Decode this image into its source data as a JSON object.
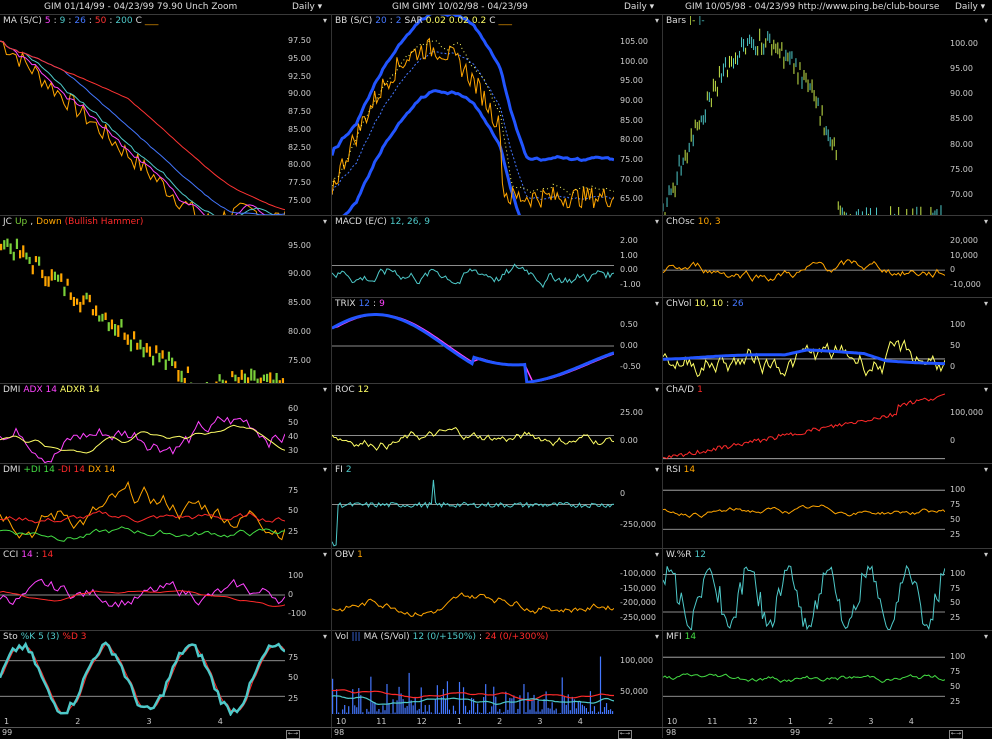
{
  "columns": [
    {
      "header": "GIM  01/14/99 - 04/23/99   79.90   Unch    Zoom",
      "period": "Daily",
      "panels": [
        {
          "legend": [
            {
              "t": "MA (S/C)",
              "c": "#dddddd"
            },
            {
              "t": "5",
              "c": "#ff44ff"
            },
            {
              "t": ":",
              "c": "#dddddd"
            },
            {
              "t": "9",
              "c": "#4ec9c9"
            },
            {
              "t": ":",
              "c": "#dddddd"
            },
            {
              "t": "26",
              "c": "#4477ff"
            },
            {
              "t": ":",
              "c": "#dddddd"
            },
            {
              "t": "50",
              "c": "#ff3333"
            },
            {
              "t": ":",
              "c": "#dddddd"
            },
            {
              "t": "200",
              "c": "#4ec9c9"
            },
            {
              "t": "C",
              "c": "#dddddd"
            },
            {
              "t": "___",
              "c": "#ffa500"
            }
          ],
          "ticks": [
            "97.50",
            "95.00",
            "92.50",
            "90.00",
            "87.50",
            "85.00",
            "82.50",
            "80.00",
            "77.50",
            "75.00"
          ]
        },
        {
          "legend": [
            {
              "t": "JC",
              "c": "#dddddd"
            },
            {
              "t": "Up",
              "c": "#7ad03a"
            },
            {
              "t": ",",
              "c": "#dddddd"
            },
            {
              "t": "Down",
              "c": "#ffa500"
            },
            {
              "t": "(Bullish Hammer)",
              "c": "#ff2a2a"
            }
          ],
          "ticks": [
            "95.00",
            "90.00",
            "85.00",
            "80.00",
            "75.00"
          ]
        },
        {
          "legend": [
            {
              "t": "DMI",
              "c": "#dddddd"
            },
            {
              "t": "ADX 14",
              "c": "#ff44ff"
            },
            {
              "t": "ADXR 14",
              "c": "#ffff66"
            }
          ],
          "ticks": [
            "60",
            "50",
            "40",
            "30"
          ]
        },
        {
          "legend": [
            {
              "t": "DMI",
              "c": "#dddddd"
            },
            {
              "t": "+DI 14",
              "c": "#44dd44"
            },
            {
              "t": "-DI 14",
              "c": "#ff2a2a"
            },
            {
              "t": "DX 14",
              "c": "#ffa500"
            }
          ],
          "ticks": [
            "75",
            "50",
            "25"
          ]
        },
        {
          "legend": [
            {
              "t": "CCI",
              "c": "#dddddd"
            },
            {
              "t": "14",
              "c": "#ff44ff"
            },
            {
              "t": ":",
              "c": "#dddddd"
            },
            {
              "t": "14",
              "c": "#ff2a2a"
            }
          ],
          "ticks": [
            "100",
            "0",
            "-100"
          ]
        },
        {
          "legend": [
            {
              "t": "Sto",
              "c": "#dddddd"
            },
            {
              "t": "%K 5 (3)",
              "c": "#4ec9c9"
            },
            {
              "t": "%D 3",
              "c": "#ff2a2a"
            }
          ],
          "ticks": [
            "75",
            "50",
            "25"
          ]
        }
      ],
      "xaxis": [
        "1",
        "2",
        "3",
        "4"
      ],
      "year": "99"
    },
    {
      "header": "GIM  GIMY   10/02/98 - 04/23/99",
      "period": "Daily",
      "panels": [
        {
          "legend": [
            {
              "t": "BB (S/C)",
              "c": "#dddddd"
            },
            {
              "t": "20",
              "c": "#4477ff"
            },
            {
              "t": ":",
              "c": "#dddddd"
            },
            {
              "t": "2",
              "c": "#4477ff"
            },
            {
              "t": "SAR",
              "c": "#dddddd"
            },
            {
              "t": "0.02",
              "c": "#ffff66"
            },
            {
              "t": "0.02",
              "c": "#ffff66"
            },
            {
              "t": "0.2",
              "c": "#ffff66"
            },
            {
              "t": "C",
              "c": "#dddddd"
            },
            {
              "t": "___",
              "c": "#ffa500"
            }
          ],
          "ticks": [
            "105.00",
            "100.00",
            "95.00",
            "90.00",
            "85.00",
            "80.00",
            "75.00",
            "70.00",
            "65.00"
          ]
        },
        {
          "legend": [
            {
              "t": "MACD (E/C)",
              "c": "#dddddd"
            },
            {
              "t": "12, 26, 9",
              "c": "#4ec9c9"
            }
          ],
          "ticks": [
            "2.00",
            "1.00",
            "0.00",
            "-1.00"
          ]
        },
        {
          "legend": [
            {
              "t": "TRIX",
              "c": "#dddddd"
            },
            {
              "t": "12",
              "c": "#4477ff"
            },
            {
              "t": ":",
              "c": "#dddddd"
            },
            {
              "t": "9",
              "c": "#ff44ff"
            }
          ],
          "ticks": [
            "0.50",
            "0.00",
            "-0.50"
          ]
        },
        {
          "legend": [
            {
              "t": "ROC",
              "c": "#dddddd"
            },
            {
              "t": "12",
              "c": "#ffff66"
            }
          ],
          "ticks": [
            "25.00",
            "0.00"
          ]
        },
        {
          "legend": [
            {
              "t": "FI",
              "c": "#dddddd"
            },
            {
              "t": "2",
              "c": "#4ec9c9"
            }
          ],
          "ticks": [
            "0",
            "-250,000"
          ]
        },
        {
          "legend": [
            {
              "t": "OBV",
              "c": "#dddddd"
            },
            {
              "t": "1",
              "c": "#ffa500"
            }
          ],
          "ticks": [
            "-100,000",
            "-150,000",
            "-200,000",
            "-250,000"
          ]
        },
        {
          "legend": [
            {
              "t": "Vol",
              "c": "#dddddd"
            },
            {
              "t": "|||",
              "c": "#4477ff"
            },
            {
              "t": "MA (S/Vol)",
              "c": "#dddddd"
            },
            {
              "t": "12 (0/+150%)",
              "c": "#4ec9c9"
            },
            {
              "t": ":",
              "c": "#dddddd"
            },
            {
              "t": "24 (0/+300%)",
              "c": "#ff2a2a"
            }
          ],
          "ticks": [
            "100,000",
            "50,000"
          ]
        }
      ],
      "xaxis": [
        "10",
        "11",
        "12",
        "1",
        "2",
        "3",
        "4"
      ],
      "year": "98"
    },
    {
      "header": "GIM  10/05/98 - 04/23/99    http://www.ping.be/club-bourse",
      "period": "Daily",
      "panels": [
        {
          "legend": [
            {
              "t": "Bars",
              "c": "#dddddd"
            },
            {
              "t": "|-",
              "c": "#c8e84a"
            },
            {
              "t": "|-",
              "c": "#4ec9c9"
            }
          ],
          "ticks": [
            "100.00",
            "95.00",
            "90.00",
            "85.00",
            "80.00",
            "75.00",
            "70.00"
          ]
        },
        {
          "legend": [
            {
              "t": "ChOsc",
              "c": "#dddddd"
            },
            {
              "t": "10, 3",
              "c": "#ffa500"
            }
          ],
          "ticks": [
            "20,000",
            "10,000",
            "0",
            "-10,000"
          ]
        },
        {
          "legend": [
            {
              "t": "ChVol",
              "c": "#dddddd"
            },
            {
              "t": "10, 10",
              "c": "#ffff66"
            },
            {
              "t": ":",
              "c": "#dddddd"
            },
            {
              "t": "26",
              "c": "#4477ff"
            }
          ],
          "ticks": [
            "100",
            "50",
            "0"
          ]
        },
        {
          "legend": [
            {
              "t": "ChA/D",
              "c": "#dddddd"
            },
            {
              "t": "1",
              "c": "#ff2a2a"
            }
          ],
          "ticks": [
            "100,000",
            "0"
          ]
        },
        {
          "legend": [
            {
              "t": "RSI",
              "c": "#dddddd"
            },
            {
              "t": "14",
              "c": "#ffa500"
            }
          ],
          "ticks": [
            "100",
            "75",
            "50",
            "25"
          ]
        },
        {
          "legend": [
            {
              "t": "W.%R",
              "c": "#dddddd"
            },
            {
              "t": "12",
              "c": "#4ec9c9"
            }
          ],
          "ticks": [
            "100",
            "75",
            "50",
            "25"
          ]
        },
        {
          "legend": [
            {
              "t": "MFI",
              "c": "#dddddd"
            },
            {
              "t": "14",
              "c": "#44dd44"
            }
          ],
          "ticks": [
            "100",
            "75",
            "50",
            "25"
          ]
        }
      ],
      "xaxis": [
        "10",
        "11",
        "12",
        "1",
        "2",
        "3",
        "4"
      ],
      "year": "98",
      "year2": "99"
    }
  ]
}
